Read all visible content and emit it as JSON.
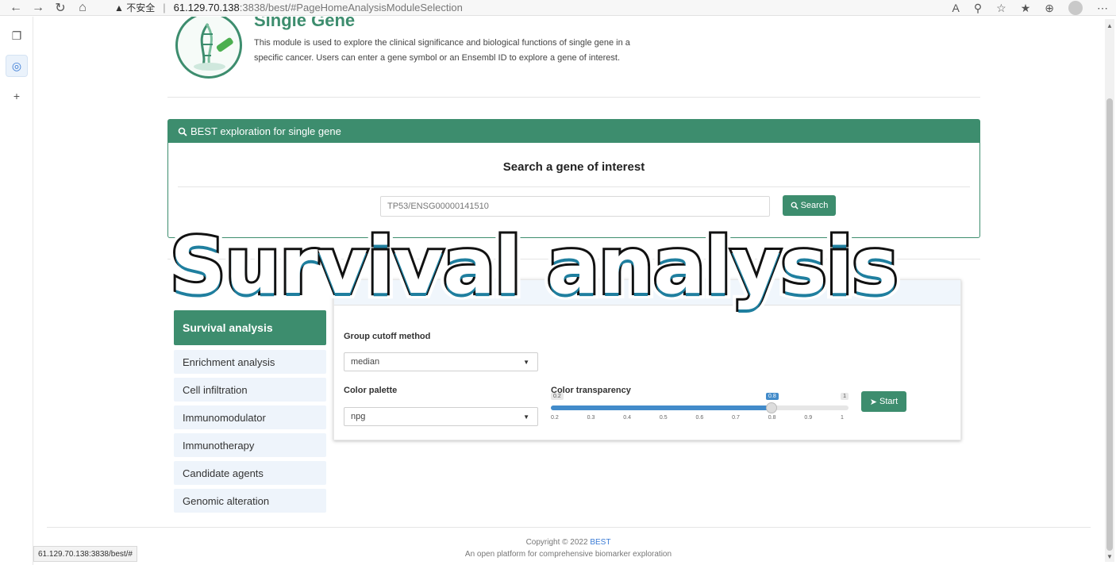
{
  "browser": {
    "back_icon": "←",
    "forward_icon": "→",
    "reload_icon": "↻",
    "home_icon": "⌂",
    "security_warning": "▲ 不安全",
    "url_host": "61.129.70.138",
    "url_path": ":3838/best/#PageHomeAnalysisModuleSelection",
    "status_url": "61.129.70.138:3838/best/#"
  },
  "module": {
    "title": "Single Gene",
    "description": "This module is used to explore the clinical significance and biological functions of single gene in a specific cancer. Users can enter a gene symbol or an Ensembl ID to explore a gene of interest."
  },
  "search_panel": {
    "header": "BEST exploration for single gene",
    "title": "Search a gene of interest",
    "placeholder": "TP53/ENSG00000141510",
    "button": "Search"
  },
  "menu": {
    "items": [
      {
        "label": "Survival analysis",
        "active": true
      },
      {
        "label": "Enrichment analysis"
      },
      {
        "label": "Cell infiltration"
      },
      {
        "label": "Immunomodulator"
      },
      {
        "label": "Immunotherapy"
      },
      {
        "label": "Candidate agents"
      },
      {
        "label": "Genomic alteration"
      }
    ]
  },
  "settings": {
    "cutoff_label": "Group cutoff method",
    "cutoff_value": "median",
    "palette_label": "Color palette",
    "palette_value": "npg",
    "transparency_label": "Color transparency",
    "transparency_min": "0.2",
    "transparency_max": "1",
    "transparency_value": "0.8",
    "transparency_fraction": 0.75,
    "ticks": [
      "0.2",
      "0.3",
      "0.4",
      "0.5",
      "0.6",
      "0.7",
      "0.8",
      "0.9",
      "1"
    ],
    "start_button": "Start"
  },
  "overlay": {
    "text": "Survival analysis"
  },
  "footer": {
    "copyright": "Copyright © 2022",
    "brand": "BEST",
    "tagline": "An open platform for comprehensive biomarker exploration"
  },
  "colors": {
    "primary_green": "#3d8d6e",
    "slider_blue": "#428bca",
    "menu_bg": "#eef4fb"
  }
}
